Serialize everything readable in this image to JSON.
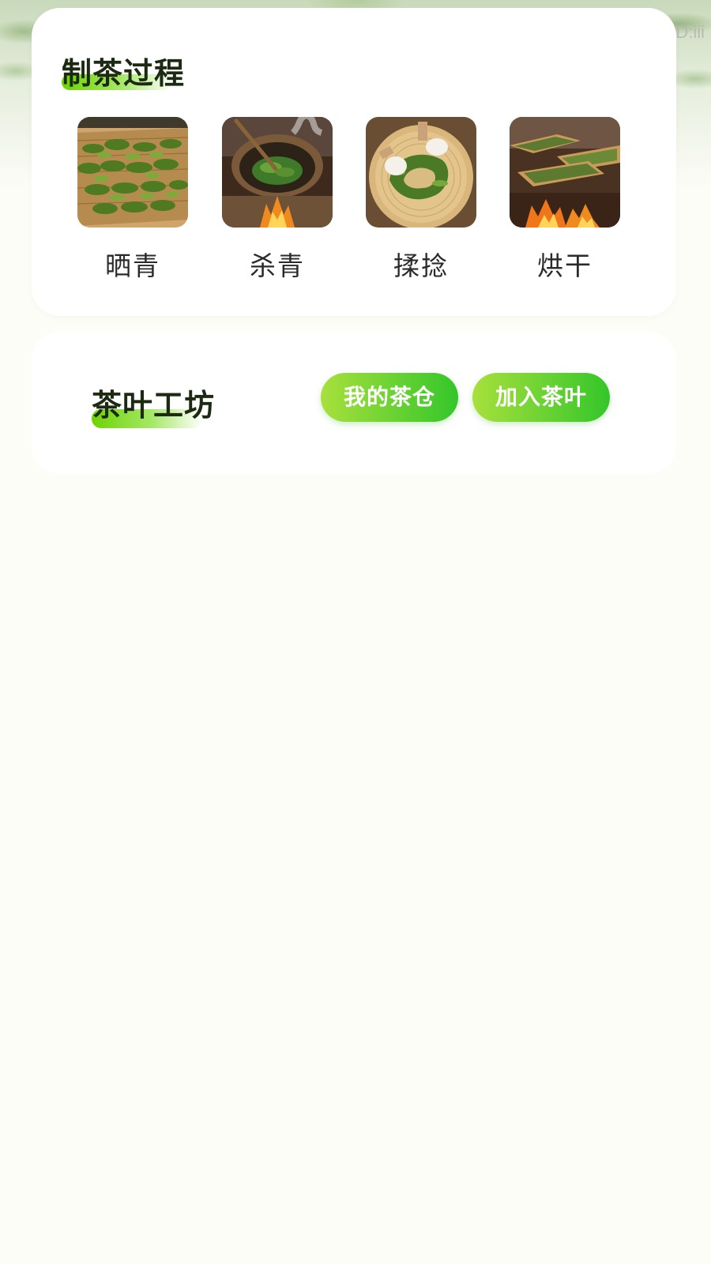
{
  "watermark": "ID:iii",
  "process_section": {
    "title": "制茶过程",
    "steps": [
      {
        "label": "晒青",
        "image": "sun-withering-tea-leaves-photo"
      },
      {
        "label": "杀青",
        "image": "wok-fixing-tea-leaves-photo"
      },
      {
        "label": "揉捻",
        "image": "hand-rolling-tea-leaves-photo"
      },
      {
        "label": "烘干",
        "image": "baking-drying-tea-leaves-photo"
      }
    ]
  },
  "workshop_section": {
    "title": "茶叶工坊",
    "buttons": {
      "my_warehouse": "我的茶仓",
      "add_tea": "加入茶叶"
    }
  },
  "colors": {
    "accent_green_start": "#a8e03c",
    "accent_green_end": "#34c62a",
    "title_text": "#1c2a12",
    "page_background": "#fdfdf8"
  }
}
